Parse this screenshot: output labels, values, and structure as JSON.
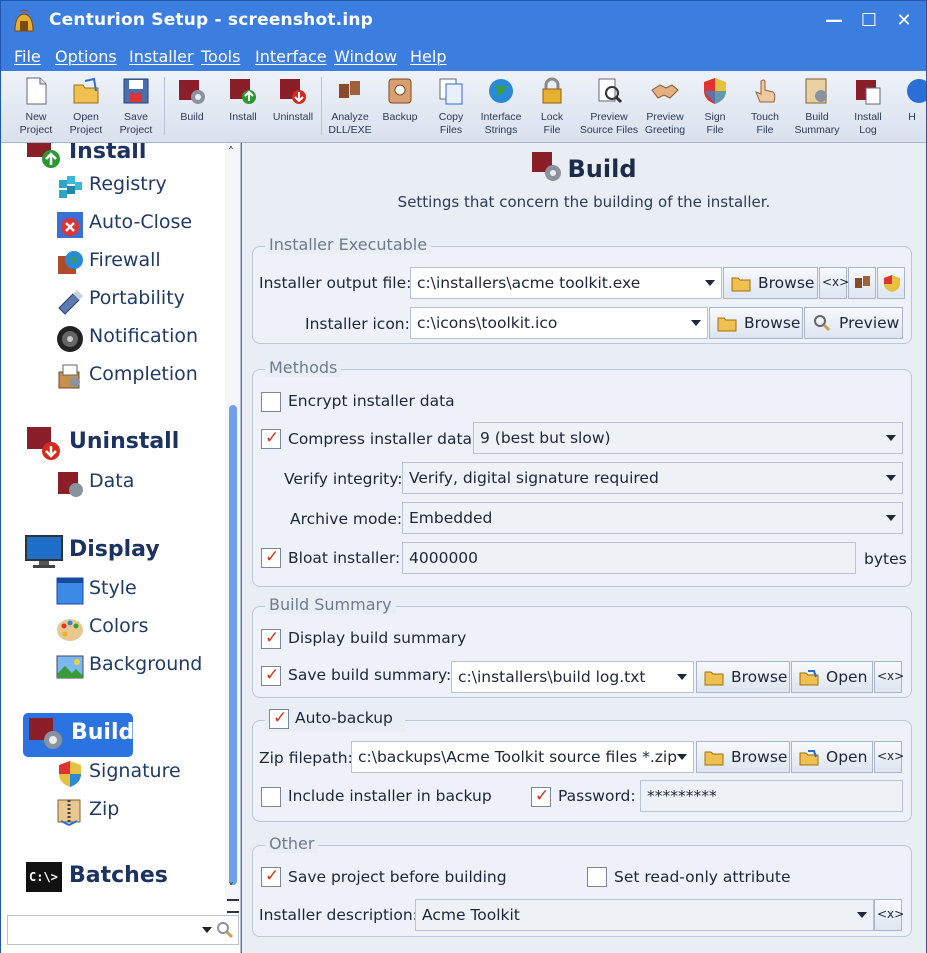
{
  "window": {
    "title": "Centurion Setup - screenshot.inp",
    "controls": [
      "—",
      "☐",
      "✕"
    ]
  },
  "menu": [
    "File",
    "Options",
    "Installer",
    "Tools",
    "Interface",
    "Window",
    "Help"
  ],
  "toolbar": [
    {
      "label": "New\nProject",
      "icon": "new-project-icon"
    },
    {
      "label": "Open\nProject",
      "icon": "open-project-icon"
    },
    {
      "label": "Save\nProject",
      "icon": "save-project-icon"
    },
    {
      "label": "Build",
      "icon": "build-icon"
    },
    {
      "label": "Install",
      "icon": "install-icon"
    },
    {
      "label": "Uninstall",
      "icon": "uninstall-icon"
    },
    {
      "label": "Analyze\nDLL/EXE",
      "icon": "analyze-icon"
    },
    {
      "label": "Backup",
      "icon": "backup-icon"
    },
    {
      "label": "Copy\nFiles",
      "icon": "copy-files-icon"
    },
    {
      "label": "Interface\nStrings",
      "icon": "globe-icon"
    },
    {
      "label": "Lock\nFile",
      "icon": "lock-icon"
    },
    {
      "label": "Preview\nSource Files",
      "icon": "preview-source-icon"
    },
    {
      "label": "Preview\nGreeting",
      "icon": "handshake-icon"
    },
    {
      "label": "Sign\nFile",
      "icon": "shield-icon"
    },
    {
      "label": "Touch\nFile",
      "icon": "touch-icon"
    },
    {
      "label": "Build\nSummary",
      "icon": "build-summary-icon"
    },
    {
      "label": "Install\nLog",
      "icon": "install-log-icon"
    },
    {
      "label": "H",
      "icon": "help-icon"
    }
  ],
  "sidebar": {
    "install_head": "Install",
    "install_items": [
      "Registry",
      "Auto-Close",
      "Firewall",
      "Portability",
      "Notification",
      "Completion"
    ],
    "uninstall_head": "Uninstall",
    "uninstall_items": [
      "Data"
    ],
    "display_head": "Display",
    "display_items": [
      "Style",
      "Colors",
      "Background"
    ],
    "build_head": "Build",
    "build_items": [
      "Signature",
      "Zip"
    ],
    "batches_head": "Batches"
  },
  "content": {
    "title": "Build",
    "subtitle": "Settings that concern the building of the installer.",
    "installer_executable": {
      "title": "Installer Executable",
      "output_label": "Installer output file:",
      "output_value": "c:\\installers\\acme toolkit.exe",
      "icon_label": "Installer icon:",
      "icon_value": "c:\\icons\\toolkit.ico",
      "browse": "Browse",
      "preview": "Preview",
      "var": "<x>"
    },
    "methods": {
      "title": "Methods",
      "encrypt": "Encrypt installer data",
      "encrypt_checked": false,
      "compress": "Compress installer data:",
      "compress_checked": true,
      "compress_value": "9 (best but slow)",
      "verify_label": "Verify integrity:",
      "verify_value": "Verify, digital signature required",
      "archive_label": "Archive mode:",
      "archive_value": "Embedded",
      "bloat": "Bloat installer:",
      "bloat_checked": true,
      "bloat_value": "4000000",
      "bytes": "bytes"
    },
    "build_summary": {
      "title": "Build Summary",
      "display": "Display build summary",
      "display_checked": true,
      "save": "Save build summary:",
      "save_checked": true,
      "save_value": "c:\\installers\\build log.txt",
      "browse": "Browse",
      "open": "Open",
      "var": "<x>"
    },
    "auto_backup": {
      "title": "Auto-backup",
      "checked": true,
      "zip_label": "Zip filepath:",
      "zip_value": "c:\\backups\\Acme Toolkit source files *.zip",
      "browse": "Browse",
      "open": "Open",
      "var": "<x>",
      "include": "Include installer in backup",
      "include_checked": false,
      "password": "Password:",
      "password_checked": true,
      "password_value": "*********"
    },
    "other": {
      "title": "Other",
      "save_project": "Save project before building",
      "save_project_checked": true,
      "readonly": "Set read-only attribute",
      "readonly_checked": false,
      "desc_label": "Installer description:",
      "desc_value": "Acme Toolkit",
      "var": "<x>"
    }
  },
  "colors": {
    "titlebar": "#3b7ee0",
    "accent": "#2a6fd6",
    "check": "#d0381a"
  }
}
